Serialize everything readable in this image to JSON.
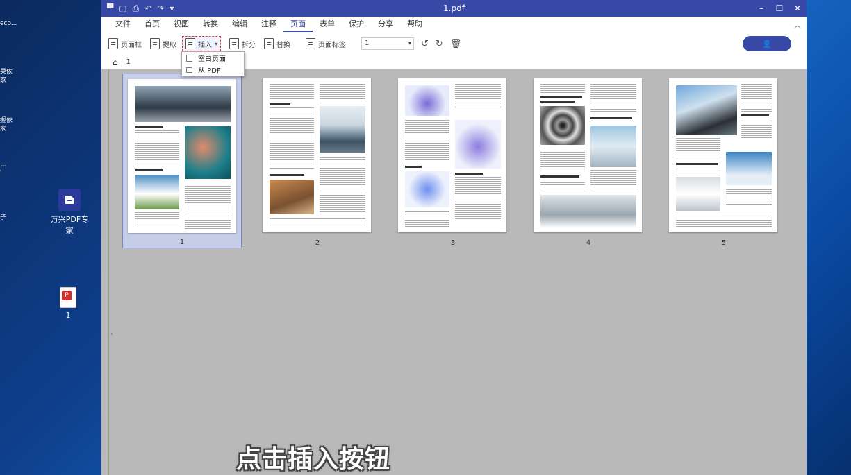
{
  "desktop": {
    "snippets": [
      "eco...",
      "果依\n家",
      "握依\n家",
      "厂",
      "子"
    ],
    "app_icon_label": "万兴PDF专家",
    "file_icon_label": "1"
  },
  "window": {
    "title": "1.pdf",
    "menu": [
      "文件",
      "首页",
      "视图",
      "转换",
      "编辑",
      "注释",
      "页面",
      "表单",
      "保护",
      "分享",
      "帮助"
    ],
    "active_menu": "页面",
    "toolbar": {
      "page_box": "页面框",
      "extract": "提取",
      "insert": "插入",
      "split": "拆分",
      "replace": "替换",
      "page_label": "页面标签",
      "page_select_value": "1"
    },
    "breadcrumb_page": "1",
    "dropdown": {
      "blank_page": "空白页面",
      "from_pdf": "从 PDF"
    },
    "pages": [
      "1",
      "2",
      "3",
      "4",
      "5"
    ]
  },
  "subtitle": "点击插入按钮"
}
